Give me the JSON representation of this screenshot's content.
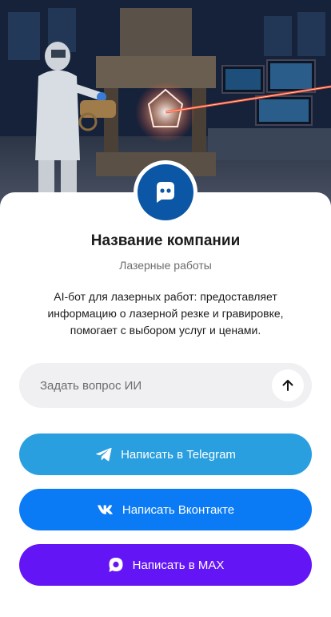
{
  "hero": {
    "image": "laser-lab-photo",
    "colors": {
      "laser": "#ff4a2a",
      "lab": "#1c2a40"
    }
  },
  "avatar": {
    "icon": "chat-bot-icon",
    "color": "#0b57a5"
  },
  "company": {
    "name": "Название компании",
    "subtitle": "Лазерные работы",
    "description": "AI-бот для лазерных работ: предоставляет информацию о лазерной резке и гравировке, помогает с выбором услуг и ценами."
  },
  "ask": {
    "placeholder": "Задать вопрос ИИ",
    "value": "",
    "send_icon": "arrow-up-icon"
  },
  "buttons": {
    "telegram": {
      "label": "Написать в Telegram",
      "icon": "telegram-icon",
      "color": "#2a9fdf"
    },
    "vk": {
      "label": "Написать Вконтакте",
      "icon": "vk-icon",
      "color": "#0a7bf5"
    },
    "max": {
      "label": "Написать в MAX",
      "icon": "max-icon",
      "color": "#6415f5"
    }
  }
}
